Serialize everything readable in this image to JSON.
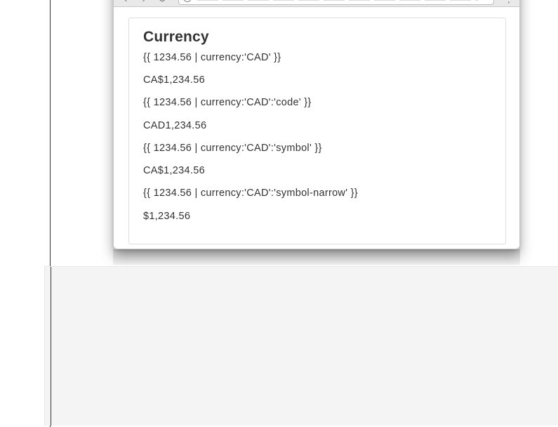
{
  "card": {
    "title": "Currency",
    "examples": [
      {
        "expression": "{{ 1234.56 | currency:'CAD' }}",
        "output": "CA$1,234.56"
      },
      {
        "expression": "{{ 1234.56 | currency:'CAD':'code' }}",
        "output": "CAD1,234.56"
      },
      {
        "expression": "{{ 1234.56 | currency:'CAD':'symbol' }}",
        "output": "CA$1,234.56"
      },
      {
        "expression": "{{ 1234.56 | currency:'CAD':'symbol-narrow' }}",
        "output": "$1,234.56"
      }
    ]
  },
  "toolbar": {
    "back_icon": "chevron-left-icon",
    "forward_icon": "chevron-right-icon",
    "reload_icon": "reload-icon",
    "menu_icon": "more-vertical-icon"
  },
  "colors": {
    "text": "#333333",
    "card_border": "#dedede",
    "toolbar_bg": "#e9e9e9",
    "bottom_panel_bg": "#f4f4f5"
  }
}
